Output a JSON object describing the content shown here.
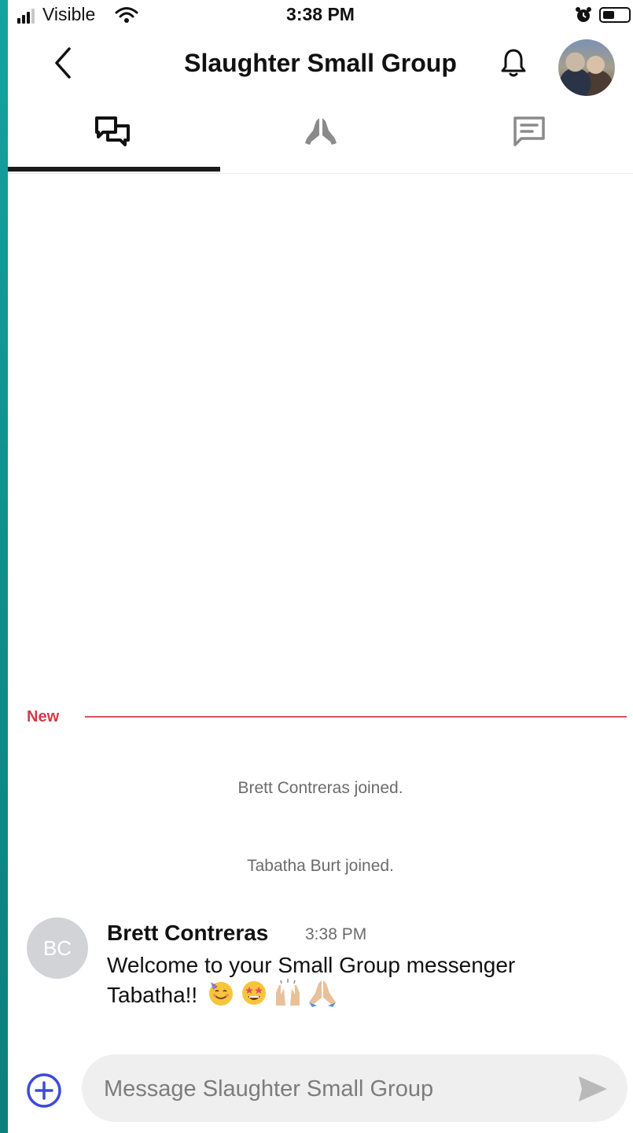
{
  "status_bar": {
    "carrier": "Visible",
    "time": "3:38 PM",
    "signal_bars": 3,
    "battery_level": 0.45
  },
  "header": {
    "title": "Slaughter Small Group",
    "back_icon": "chevron-left-icon",
    "bell_icon": "bell-icon",
    "avatar": "group-photo"
  },
  "tabs": [
    {
      "icon": "chat-bubbles-icon",
      "active": true
    },
    {
      "icon": "praying-hands-icon",
      "active": false
    },
    {
      "icon": "message-square-icon",
      "active": false
    }
  ],
  "divider": {
    "label": "New",
    "color": "#d23b4a"
  },
  "system_messages": [
    "Brett Contreras joined.",
    "Tabatha Burt joined."
  ],
  "message": {
    "avatar_initials": "BC",
    "author": "Brett Contreras",
    "time": "3:38 PM",
    "text": "Welcome to your Small Group messenger Tabatha!!",
    "emojis": [
      "partying-face",
      "star-struck",
      "raising-hands",
      "folded-hands"
    ]
  },
  "composer": {
    "placeholder": "Message Slaughter Small Group",
    "value": "",
    "add_icon": "plus-circle-icon",
    "send_icon": "send-icon"
  },
  "colors": {
    "accent": "#3b4bd8",
    "new_divider": "#d9505d",
    "page_edge": "#0f8f8c"
  }
}
